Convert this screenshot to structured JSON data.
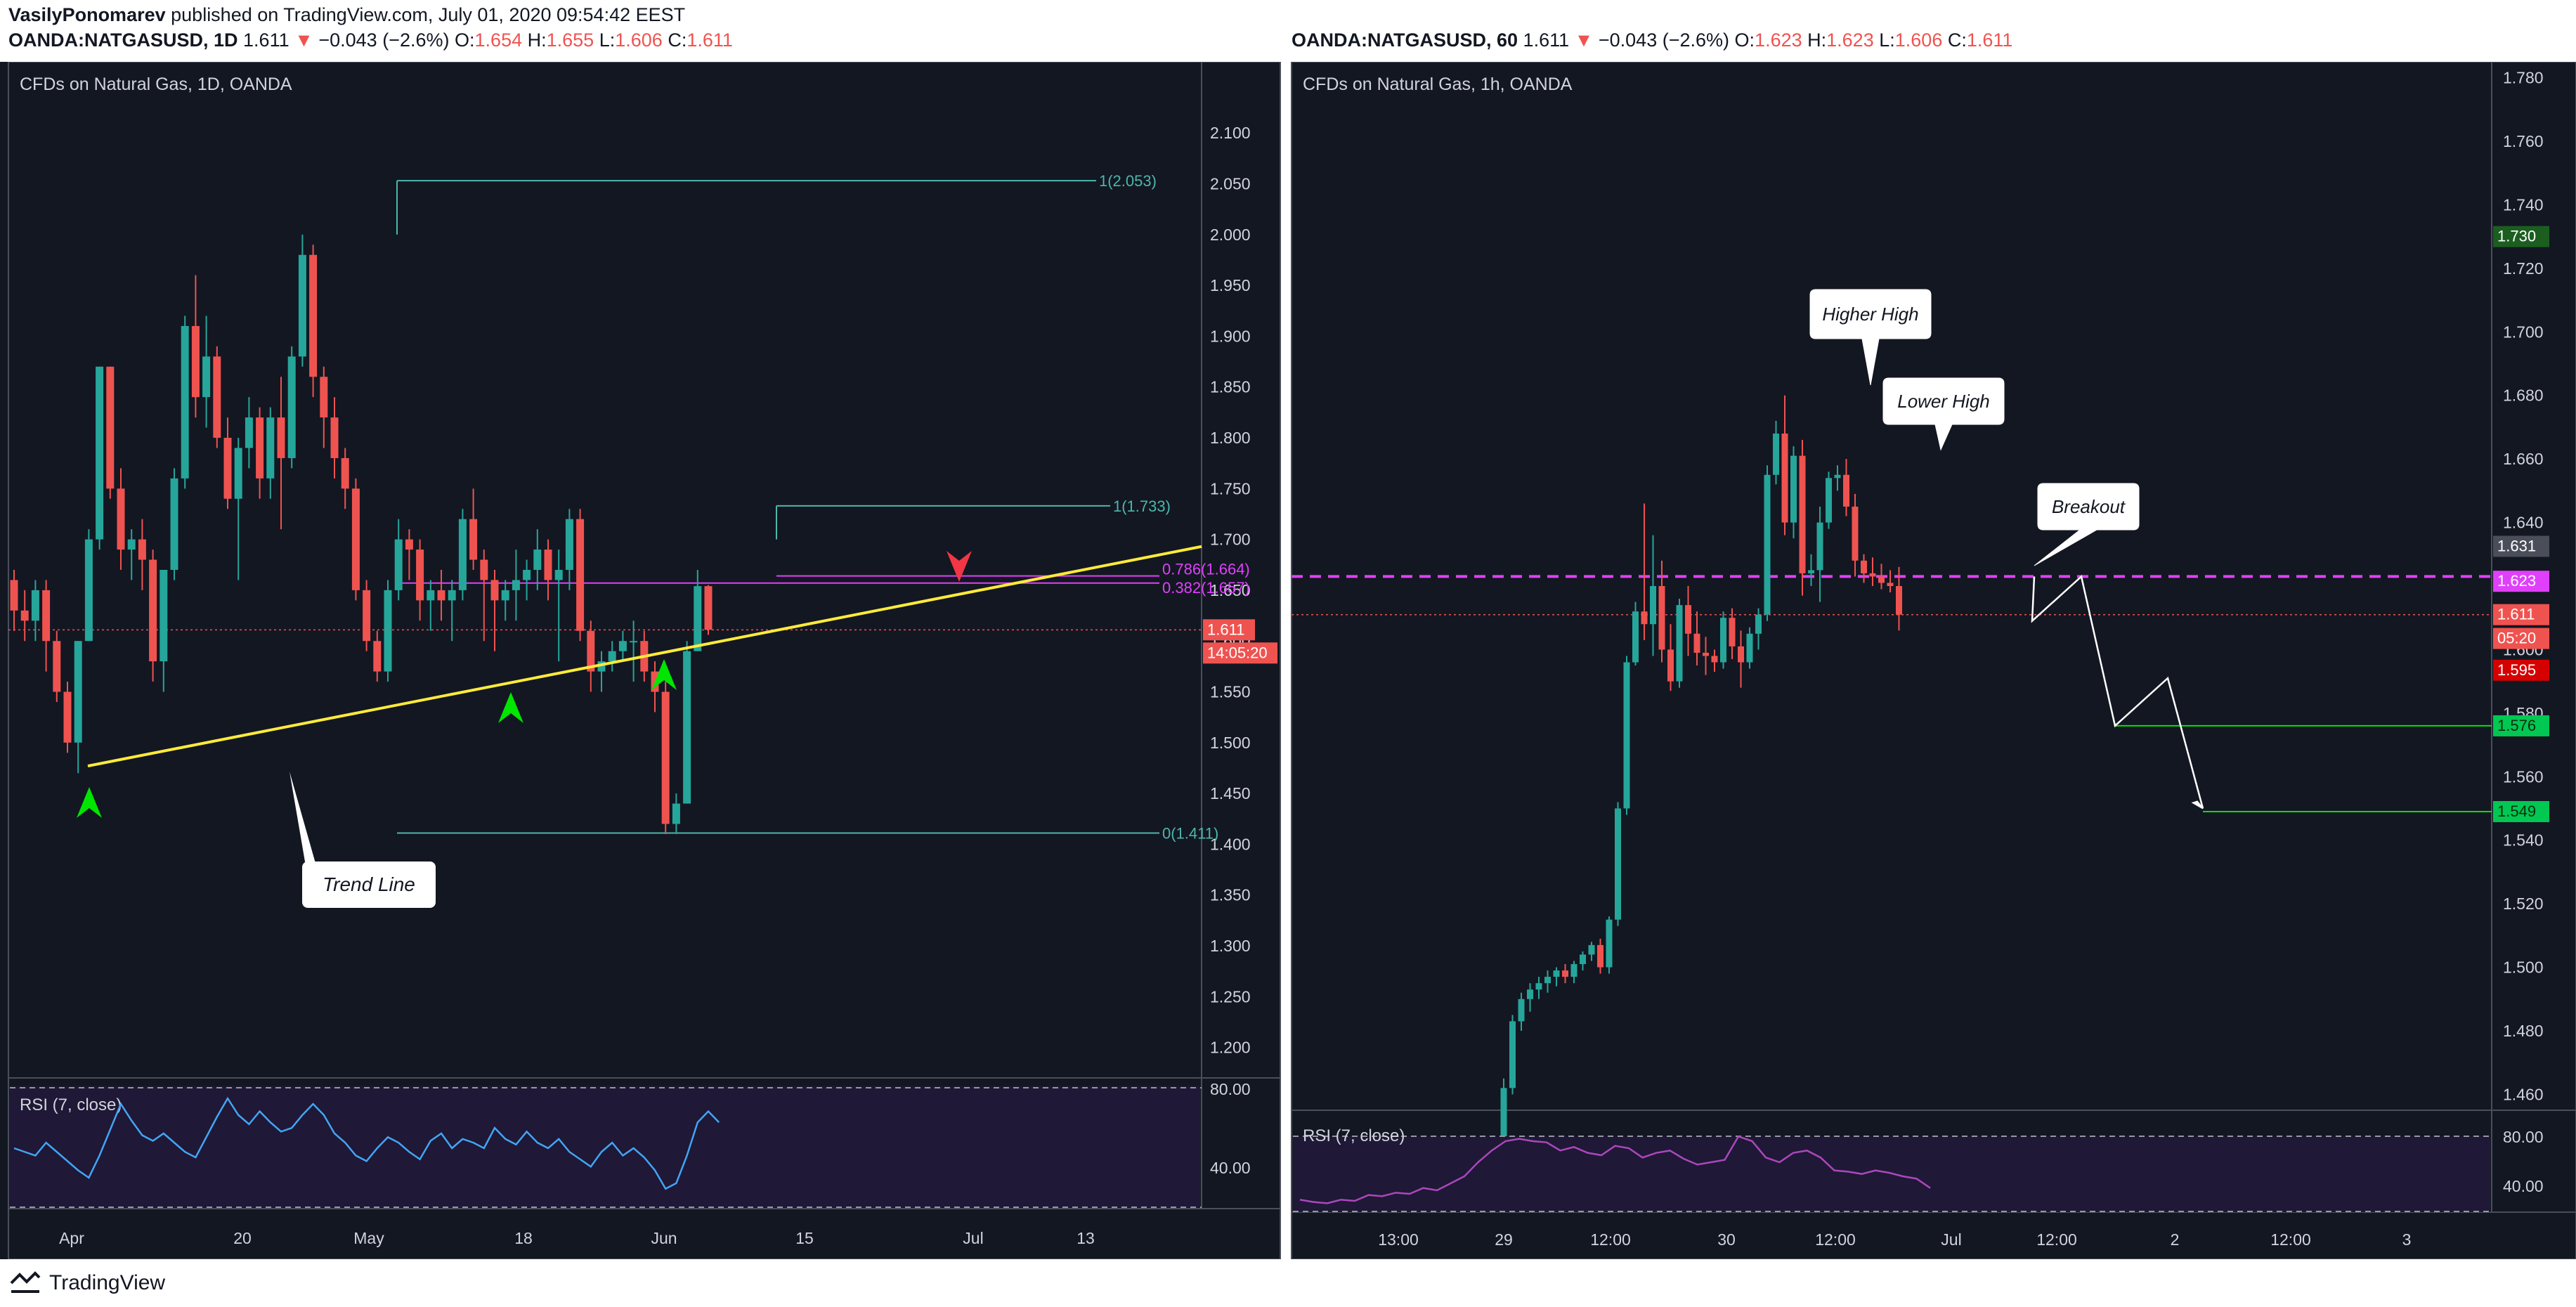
{
  "header": {
    "author": "VasilyPonomarev",
    "published_text": "published on TradingView.com, July 01, 2020 09:54:42 EEST",
    "left_symbol": "OANDA:NATGASUSD, 1D",
    "left_last": "1.611",
    "left_change": "−0.043 (−2.6%)",
    "left_o_label": "O:",
    "left_o": "1.654",
    "left_h_label": "H:",
    "left_h": "1.655",
    "left_l_label": "L:",
    "left_l": "1.606",
    "left_c_label": "C:",
    "left_c": "1.611",
    "right_symbol": "OANDA:NATGASUSD, 60",
    "right_last": "1.611",
    "right_change": "−0.043 (−2.6%)",
    "right_o_label": "O:",
    "right_o": "1.623",
    "right_h_label": "H:",
    "right_h": "1.623",
    "right_l_label": "L:",
    "right_l": "1.606",
    "right_c_label": "C:",
    "right_c": "1.611"
  },
  "footer": {
    "brand": "TradingView"
  },
  "colors": {
    "background": "#131722",
    "up": "#26a69a",
    "down": "#ef5350",
    "trendline": "#ffeb3b",
    "fib": "#4db6ac",
    "magenta": "#e040fb",
    "rsi_line": "#42a5f5",
    "rsi_line_right": "#ab47bc",
    "rsi_bg": "#1f1836",
    "target": "#00e600"
  },
  "chart_data": [
    {
      "type": "candlestick",
      "title": "CFDs on Natural Gas, 1D, OANDA",
      "ylim": [
        1.17,
        2.17
      ],
      "y_ticks": [
        "2.100",
        "2.050",
        "2.000",
        "1.950",
        "1.900",
        "1.850",
        "1.800",
        "1.750",
        "1.700",
        "1.650",
        "1.600",
        "1.550",
        "1.500",
        "1.450",
        "1.400",
        "1.350",
        "1.300",
        "1.250",
        "1.200"
      ],
      "x_ticks": [
        "Apr",
        "20",
        "May",
        "18",
        "Jun",
        "15",
        "Jul",
        "13"
      ],
      "last_price_label": "1.611",
      "countdown_label": "14:05:20",
      "candles": [
        {
          "o": 1.66,
          "h": 1.67,
          "l": 1.61,
          "c": 1.63
        },
        {
          "o": 1.63,
          "h": 1.65,
          "l": 1.6,
          "c": 1.62
        },
        {
          "o": 1.62,
          "h": 1.66,
          "l": 1.6,
          "c": 1.65
        },
        {
          "o": 1.65,
          "h": 1.66,
          "l": 1.57,
          "c": 1.6
        },
        {
          "o": 1.6,
          "h": 1.61,
          "l": 1.54,
          "c": 1.55
        },
        {
          "o": 1.55,
          "h": 1.56,
          "l": 1.49,
          "c": 1.5
        },
        {
          "o": 1.5,
          "h": 1.6,
          "l": 1.47,
          "c": 1.6
        },
        {
          "o": 1.6,
          "h": 1.71,
          "l": 1.6,
          "c": 1.7
        },
        {
          "o": 1.7,
          "h": 1.87,
          "l": 1.69,
          "c": 1.87
        },
        {
          "o": 1.87,
          "h": 1.87,
          "l": 1.74,
          "c": 1.75
        },
        {
          "o": 1.75,
          "h": 1.77,
          "l": 1.67,
          "c": 1.69
        },
        {
          "o": 1.69,
          "h": 1.71,
          "l": 1.66,
          "c": 1.7
        },
        {
          "o": 1.7,
          "h": 1.72,
          "l": 1.65,
          "c": 1.68
        },
        {
          "o": 1.68,
          "h": 1.69,
          "l": 1.56,
          "c": 1.58
        },
        {
          "o": 1.58,
          "h": 1.59,
          "l": 1.55,
          "c": 1.67
        },
        {
          "o": 1.67,
          "h": 1.77,
          "l": 1.66,
          "c": 1.76
        },
        {
          "o": 1.76,
          "h": 1.92,
          "l": 1.75,
          "c": 1.91
        },
        {
          "o": 1.91,
          "h": 1.96,
          "l": 1.82,
          "c": 1.84
        },
        {
          "o": 1.84,
          "h": 1.92,
          "l": 1.81,
          "c": 1.88
        },
        {
          "o": 1.88,
          "h": 1.89,
          "l": 1.79,
          "c": 1.8
        },
        {
          "o": 1.8,
          "h": 1.82,
          "l": 1.73,
          "c": 1.74
        },
        {
          "o": 1.74,
          "h": 1.8,
          "l": 1.66,
          "c": 1.79
        },
        {
          "o": 1.79,
          "h": 1.84,
          "l": 1.77,
          "c": 1.82
        },
        {
          "o": 1.82,
          "h": 1.83,
          "l": 1.74,
          "c": 1.76
        },
        {
          "o": 1.76,
          "h": 1.83,
          "l": 1.74,
          "c": 1.82
        },
        {
          "o": 1.82,
          "h": 1.86,
          "l": 1.71,
          "c": 1.78
        },
        {
          "o": 1.78,
          "h": 1.89,
          "l": 1.77,
          "c": 1.88
        },
        {
          "o": 1.88,
          "h": 2.0,
          "l": 1.87,
          "c": 1.98
        },
        {
          "o": 1.98,
          "h": 1.99,
          "l": 1.84,
          "c": 1.86
        },
        {
          "o": 1.86,
          "h": 1.87,
          "l": 1.79,
          "c": 1.82
        },
        {
          "o": 1.82,
          "h": 1.84,
          "l": 1.76,
          "c": 1.78
        },
        {
          "o": 1.78,
          "h": 1.79,
          "l": 1.73,
          "c": 1.75
        },
        {
          "o": 1.75,
          "h": 1.76,
          "l": 1.64,
          "c": 1.65
        },
        {
          "o": 1.65,
          "h": 1.66,
          "l": 1.59,
          "c": 1.6
        },
        {
          "o": 1.6,
          "h": 1.61,
          "l": 1.56,
          "c": 1.57
        },
        {
          "o": 1.57,
          "h": 1.66,
          "l": 1.56,
          "c": 1.65
        },
        {
          "o": 1.65,
          "h": 1.72,
          "l": 1.64,
          "c": 1.7
        },
        {
          "o": 1.7,
          "h": 1.71,
          "l": 1.66,
          "c": 1.69
        },
        {
          "o": 1.69,
          "h": 1.7,
          "l": 1.62,
          "c": 1.64
        },
        {
          "o": 1.64,
          "h": 1.66,
          "l": 1.61,
          "c": 1.65
        },
        {
          "o": 1.65,
          "h": 1.67,
          "l": 1.62,
          "c": 1.64
        },
        {
          "o": 1.64,
          "h": 1.66,
          "l": 1.6,
          "c": 1.65
        },
        {
          "o": 1.65,
          "h": 1.73,
          "l": 1.64,
          "c": 1.72
        },
        {
          "o": 1.72,
          "h": 1.75,
          "l": 1.67,
          "c": 1.68
        },
        {
          "o": 1.68,
          "h": 1.69,
          "l": 1.6,
          "c": 1.66
        },
        {
          "o": 1.66,
          "h": 1.67,
          "l": 1.59,
          "c": 1.64
        },
        {
          "o": 1.64,
          "h": 1.66,
          "l": 1.62,
          "c": 1.65
        },
        {
          "o": 1.65,
          "h": 1.69,
          "l": 1.62,
          "c": 1.66
        },
        {
          "o": 1.66,
          "h": 1.68,
          "l": 1.64,
          "c": 1.67
        },
        {
          "o": 1.67,
          "h": 1.71,
          "l": 1.65,
          "c": 1.69
        },
        {
          "o": 1.69,
          "h": 1.7,
          "l": 1.64,
          "c": 1.66
        },
        {
          "o": 1.66,
          "h": 1.69,
          "l": 1.58,
          "c": 1.67
        },
        {
          "o": 1.67,
          "h": 1.73,
          "l": 1.65,
          "c": 1.72
        },
        {
          "o": 1.72,
          "h": 1.73,
          "l": 1.6,
          "c": 1.61
        },
        {
          "o": 1.61,
          "h": 1.62,
          "l": 1.55,
          "c": 1.57
        },
        {
          "o": 1.57,
          "h": 1.59,
          "l": 1.55,
          "c": 1.58
        },
        {
          "o": 1.58,
          "h": 1.6,
          "l": 1.57,
          "c": 1.59
        },
        {
          "o": 1.59,
          "h": 1.61,
          "l": 1.58,
          "c": 1.6
        },
        {
          "o": 1.6,
          "h": 1.62,
          "l": 1.56,
          "c": 1.6
        },
        {
          "o": 1.6,
          "h": 1.61,
          "l": 1.56,
          "c": 1.57
        },
        {
          "o": 1.57,
          "h": 1.58,
          "l": 1.53,
          "c": 1.55
        },
        {
          "o": 1.55,
          "h": 1.56,
          "l": 1.41,
          "c": 1.42
        },
        {
          "o": 1.42,
          "h": 1.45,
          "l": 1.41,
          "c": 1.44
        },
        {
          "o": 1.44,
          "h": 1.6,
          "l": 1.44,
          "c": 1.59
        },
        {
          "o": 1.59,
          "h": 1.67,
          "l": 1.59,
          "c": 1.654
        },
        {
          "o": 1.654,
          "h": 1.655,
          "l": 1.606,
          "c": 1.611
        }
      ],
      "fibonacci": [
        {
          "label": "1(2.053)",
          "value": 2.053
        },
        {
          "label": "1(1.733)",
          "value": 1.733
        },
        {
          "label": "0.786(1.664)",
          "value": 1.664
        },
        {
          "label": "0.382(1.657)",
          "value": 1.657
        },
        {
          "label": "0(1.411)",
          "value": 1.411
        }
      ],
      "horizontal_line": 1.657,
      "trendline": {
        "from": [
          0,
          1.477
        ],
        "to": [
          73,
          1.693
        ]
      },
      "annotations": [
        {
          "text": "Trend Line"
        }
      ],
      "rsi": {
        "label": "RSI (7, close)",
        "levels": [
          "80.00",
          "40.00"
        ],
        "values": [
          52,
          50,
          48,
          55,
          50,
          45,
          40,
          36,
          48,
          62,
          76,
          67,
          59,
          56,
          60,
          55,
          50,
          47,
          58,
          69,
          79,
          70,
          65,
          72,
          66,
          61,
          63,
          70,
          76,
          70,
          60,
          55,
          48,
          45,
          52,
          58,
          55,
          50,
          46,
          56,
          60,
          52,
          57,
          55,
          52,
          63,
          57,
          54,
          61,
          55,
          52,
          57,
          50,
          46,
          42,
          50,
          55,
          48,
          52,
          47,
          40,
          30,
          33,
          48,
          66,
          72,
          66
        ]
      }
    },
    {
      "type": "candlestick",
      "title": "CFDs on Natural Gas, 1h, OANDA",
      "ylim": [
        1.455,
        1.785
      ],
      "y_ticks": [
        "1.780",
        "1.760",
        "1.740",
        "1.720",
        "1.700",
        "1.680",
        "1.660",
        "1.640",
        "1.620",
        "1.600",
        "1.580",
        "1.560",
        "1.540",
        "1.520",
        "1.500",
        "1.480",
        "1.460"
      ],
      "x_ticks": [
        "13:00",
        "29",
        "12:00",
        "30",
        "12:00",
        "Jul",
        "12:00",
        "2",
        "12:00",
        "3"
      ],
      "price_labels": [
        "1.730",
        "1.631",
        "1.623",
        "1.611",
        "05:20",
        "1.595",
        "1.576",
        "1.549"
      ],
      "candles": [
        {
          "o": 1.44,
          "h": 1.465,
          "l": 1.438,
          "c": 1.462
        },
        {
          "o": 1.462,
          "h": 1.485,
          "l": 1.46,
          "c": 1.483
        },
        {
          "o": 1.483,
          "h": 1.492,
          "l": 1.48,
          "c": 1.49
        },
        {
          "o": 1.49,
          "h": 1.495,
          "l": 1.486,
          "c": 1.493
        },
        {
          "o": 1.493,
          "h": 1.497,
          "l": 1.49,
          "c": 1.495
        },
        {
          "o": 1.495,
          "h": 1.499,
          "l": 1.492,
          "c": 1.497
        },
        {
          "o": 1.497,
          "h": 1.5,
          "l": 1.494,
          "c": 1.499
        },
        {
          "o": 1.499,
          "h": 1.501,
          "l": 1.495,
          "c": 1.497
        },
        {
          "o": 1.497,
          "h": 1.502,
          "l": 1.495,
          "c": 1.501
        },
        {
          "o": 1.501,
          "h": 1.505,
          "l": 1.499,
          "c": 1.504
        },
        {
          "o": 1.504,
          "h": 1.508,
          "l": 1.502,
          "c": 1.507
        },
        {
          "o": 1.507,
          "h": 1.509,
          "l": 1.498,
          "c": 1.5
        },
        {
          "o": 1.5,
          "h": 1.516,
          "l": 1.498,
          "c": 1.515
        },
        {
          "o": 1.515,
          "h": 1.552,
          "l": 1.513,
          "c": 1.55
        },
        {
          "o": 1.55,
          "h": 1.598,
          "l": 1.548,
          "c": 1.596
        },
        {
          "o": 1.596,
          "h": 1.615,
          "l": 1.595,
          "c": 1.612
        },
        {
          "o": 1.612,
          "h": 1.646,
          "l": 1.603,
          "c": 1.608
        },
        {
          "o": 1.608,
          "h": 1.636,
          "l": 1.598,
          "c": 1.62
        },
        {
          "o": 1.62,
          "h": 1.628,
          "l": 1.596,
          "c": 1.6
        },
        {
          "o": 1.6,
          "h": 1.608,
          "l": 1.587,
          "c": 1.59
        },
        {
          "o": 1.59,
          "h": 1.616,
          "l": 1.588,
          "c": 1.614
        },
        {
          "o": 1.614,
          "h": 1.62,
          "l": 1.598,
          "c": 1.605
        },
        {
          "o": 1.605,
          "h": 1.612,
          "l": 1.595,
          "c": 1.599
        },
        {
          "o": 1.599,
          "h": 1.604,
          "l": 1.592,
          "c": 1.598
        },
        {
          "o": 1.598,
          "h": 1.6,
          "l": 1.593,
          "c": 1.596
        },
        {
          "o": 1.596,
          "h": 1.612,
          "l": 1.594,
          "c": 1.61
        },
        {
          "o": 1.61,
          "h": 1.613,
          "l": 1.597,
          "c": 1.601
        },
        {
          "o": 1.601,
          "h": 1.606,
          "l": 1.588,
          "c": 1.596
        },
        {
          "o": 1.596,
          "h": 1.607,
          "l": 1.594,
          "c": 1.605
        },
        {
          "o": 1.605,
          "h": 1.613,
          "l": 1.6,
          "c": 1.611
        },
        {
          "o": 1.611,
          "h": 1.658,
          "l": 1.609,
          "c": 1.655
        },
        {
          "o": 1.655,
          "h": 1.672,
          "l": 1.652,
          "c": 1.668
        },
        {
          "o": 1.668,
          "h": 1.68,
          "l": 1.636,
          "c": 1.64
        },
        {
          "o": 1.64,
          "h": 1.664,
          "l": 1.635,
          "c": 1.661
        },
        {
          "o": 1.661,
          "h": 1.666,
          "l": 1.617,
          "c": 1.624
        },
        {
          "o": 1.624,
          "h": 1.63,
          "l": 1.62,
          "c": 1.625
        },
        {
          "o": 1.625,
          "h": 1.645,
          "l": 1.615,
          "c": 1.64
        },
        {
          "o": 1.64,
          "h": 1.656,
          "l": 1.638,
          "c": 1.654
        },
        {
          "o": 1.654,
          "h": 1.658,
          "l": 1.65,
          "c": 1.655
        },
        {
          "o": 1.655,
          "h": 1.66,
          "l": 1.642,
          "c": 1.645
        },
        {
          "o": 1.645,
          "h": 1.649,
          "l": 1.623,
          "c": 1.628
        },
        {
          "o": 1.628,
          "h": 1.63,
          "l": 1.621,
          "c": 1.624
        },
        {
          "o": 1.624,
          "h": 1.629,
          "l": 1.62,
          "c": 1.623
        },
        {
          "o": 1.623,
          "h": 1.627,
          "l": 1.619,
          "c": 1.621
        },
        {
          "o": 1.621,
          "h": 1.625,
          "l": 1.618,
          "c": 1.62
        },
        {
          "o": 1.62,
          "h": 1.626,
          "l": 1.606,
          "c": 1.611
        }
      ],
      "horizontal_lines": [
        1.623,
        1.576,
        1.549
      ],
      "projection_path": [
        [
          45,
          1.623
        ],
        [
          46,
          1.609
        ],
        [
          47,
          1.623
        ],
        [
          52,
          1.576
        ],
        [
          56,
          1.591
        ],
        [
          61,
          1.55
        ]
      ],
      "annotations": [
        {
          "text": "Higher High"
        },
        {
          "text": "Lower High"
        },
        {
          "text": "Breakout"
        }
      ],
      "rsi": {
        "label": "RSI (7, close)",
        "levels": [
          "80.00",
          "40.00"
        ],
        "values": [
          30,
          28,
          27,
          30,
          29,
          34,
          33,
          36,
          35,
          40,
          38,
          44,
          50,
          62,
          72,
          80,
          82,
          80,
          79,
          72,
          75,
          70,
          68,
          76,
          74,
          66,
          70,
          72,
          65,
          60,
          62,
          64,
          84,
          80,
          66,
          62,
          70,
          72,
          66,
          55,
          54,
          52,
          55,
          53,
          50,
          48,
          40
        ]
      }
    }
  ]
}
